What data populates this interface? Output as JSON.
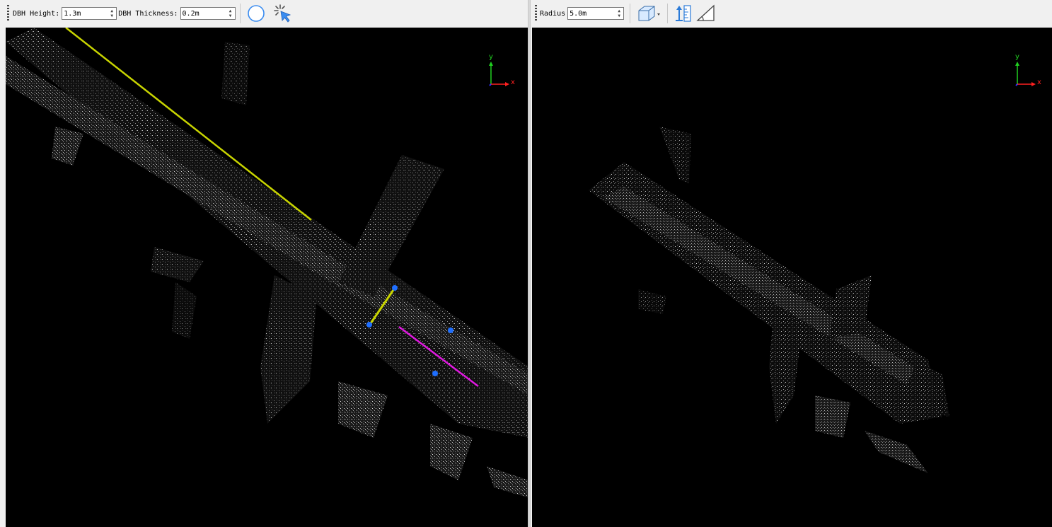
{
  "left_toolbar": {
    "dbh_height_label": "DBH Height:",
    "dbh_height_value": "1.3m",
    "dbh_thickness_label": "DBH Thickness:",
    "dbh_thickness_value": "0.2m",
    "circle_tool_icon": "circle-icon",
    "pick_tool_icon": "cursor-select-icon"
  },
  "right_toolbar": {
    "radius_label": "Radius",
    "radius_value": "5.0m",
    "view_cube_icon": "view-cube-icon",
    "height_measure_icon": "height-measure-icon",
    "angle_measure_icon": "angle-measure-icon"
  },
  "left_view": {
    "axis": {
      "x_label": "x",
      "y_label": "y"
    },
    "overlays": {
      "tree_line_color": "#c8d400",
      "measure_line_color": "#e018e0",
      "point_marker_color": "#1f6fff"
    }
  },
  "right_view": {
    "axis": {
      "x_label": "x",
      "y_label": "y"
    }
  },
  "colors": {
    "viewport_bg": "#000000",
    "toolbar_bg": "#f0f0f0",
    "axis_x": "#ff2020",
    "axis_y": "#20d020",
    "axis_z": "#3030ff"
  }
}
